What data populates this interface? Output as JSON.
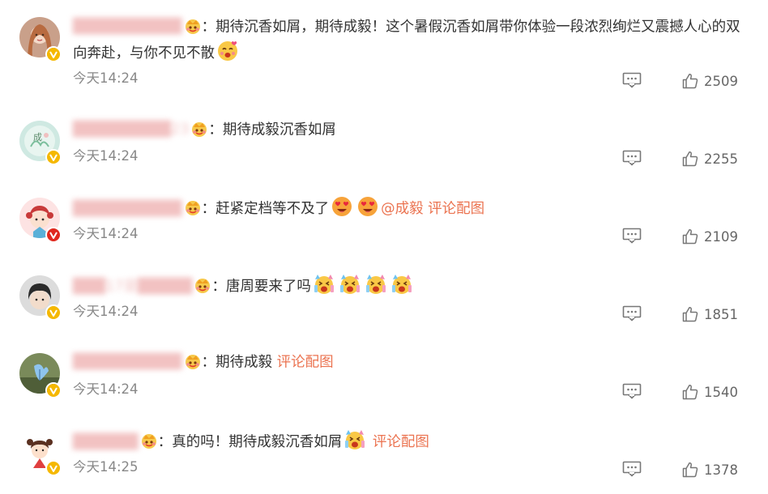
{
  "comments": [
    {
      "username": "██████████",
      "text": "：期待沉香如屑，期待成毅！这个暑假沉香如屑带你体验一段浓烈绚烂又震撼人心的双向奔赴，与你不见不散",
      "time": "今天14:24",
      "likes": "2509",
      "badge": "gold-v",
      "emoji": [
        "love-face"
      ]
    },
    {
      "username": "█████████23",
      "text": "：期待成毅沉香如屑",
      "time": "今天14:24",
      "likes": "2255",
      "badge": "gold-v"
    },
    {
      "username": "██████████",
      "text": "：赶紧定档等不及了",
      "mention": "@成毅",
      "pic_link": "评论配图",
      "time": "今天14:24",
      "likes": "2109",
      "badge": "red-v",
      "emoji": [
        "heart-eyes-face",
        "heart-eyes-face"
      ]
    },
    {
      "username": "███17是█████",
      "text": "：唐周要来了吗",
      "time": "今天14:24",
      "likes": "1851",
      "badge": "gold-v",
      "emoji": [
        "excited-face",
        "excited-face",
        "excited-face",
        "excited-face"
      ]
    },
    {
      "username": "██████████",
      "text": "：期待成毅",
      "pic_link": "评论配图",
      "time": "今天14:24",
      "likes": "1540",
      "badge": "gold-v"
    },
    {
      "username": "██████",
      "text": "：真的吗！期待成毅沉香如屑",
      "pic_link": "评论配图",
      "time": "今天14:25",
      "likes": "1378",
      "badge": "gold-v",
      "emoji": [
        "excited-face"
      ]
    }
  ],
  "colors": {
    "link": "#eb7350",
    "gold_badge": "#f5b800",
    "red_badge": "#e0281e",
    "timestamp": "#888888"
  }
}
